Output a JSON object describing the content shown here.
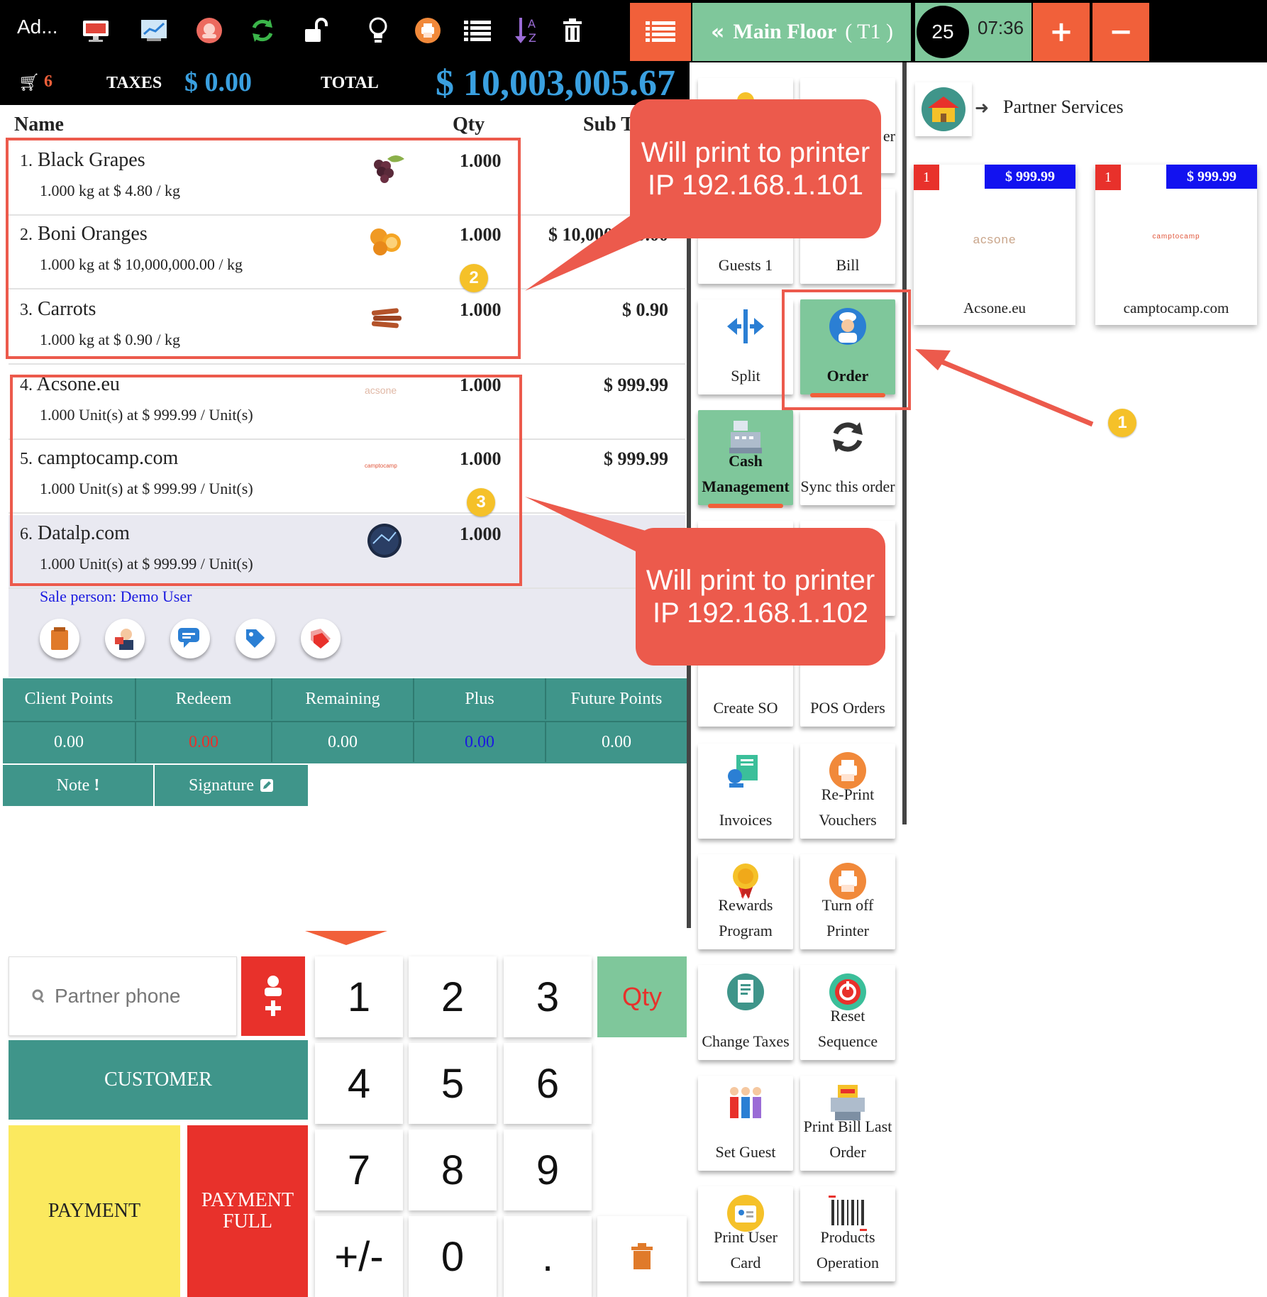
{
  "toolbar": {
    "user_name": "Ad...",
    "floor_label": "Main Floor",
    "table_label": "( T1 )",
    "guest_count": "25",
    "clock": "07:36",
    "plus_label": "+",
    "minus_label": "−"
  },
  "totals": {
    "cart_count": "6",
    "taxes_label": "TAXES",
    "taxes_value": "$ 0.00",
    "total_label": "TOTAL",
    "total_value": "$ 10,003,005.67"
  },
  "order": {
    "col_name": "Name",
    "col_qty": "Qty",
    "col_sub": "Sub T",
    "lines": [
      {
        "num": "1.",
        "name": "Black Grapes",
        "detail": "1.000 kg at $ 4.80 / kg",
        "qty": "1.000",
        "sub": "$"
      },
      {
        "num": "2.",
        "name": "Boni Oranges",
        "detail": "1.000 kg at $ 10,000,000.00 / kg",
        "qty": "1.000",
        "sub": "$ 10,000,000.00"
      },
      {
        "num": "3.",
        "name": "Carrots",
        "detail": "1.000 kg at $ 0.90 / kg",
        "qty": "1.000",
        "sub": "$ 0.90"
      },
      {
        "num": "4.",
        "name": "Acsone.eu",
        "detail": "1.000 Unit(s) at $ 999.99 / Unit(s)",
        "qty": "1.000",
        "sub": "$ 999.99"
      },
      {
        "num": "5.",
        "name": "camptocamp.com",
        "detail": "1.000 Unit(s) at $ 999.99 / Unit(s)",
        "qty": "1.000",
        "sub": "$ 999.99"
      },
      {
        "num": "6.",
        "name": "Datalp.com",
        "detail": "1.000 Unit(s) at $ 999.99 / Unit(s)",
        "qty": "1.000",
        "sub": ""
      }
    ],
    "salesperson": "Sale person: Demo User",
    "line4_logo": "acsone",
    "line5_logo": "camptocamp"
  },
  "loyalty": {
    "headers": [
      "Client Points",
      "Redeem",
      "Remaining",
      "Plus",
      "Future Points"
    ],
    "values": [
      "0.00",
      "0.00",
      "0.00",
      "0.00",
      "0.00"
    ],
    "note_label": "Note",
    "signature_label": "Signature"
  },
  "controls": {
    "partner_placeholder": "Partner phone",
    "customer_label": "CUSTOMER",
    "payment_label": "PAYMENT",
    "payment_full_label": "PAYMENT FULL",
    "keys": [
      "1",
      "2",
      "3",
      "4",
      "5",
      "6",
      "7",
      "8",
      "9",
      "+/-",
      "0",
      "."
    ],
    "qty_label": "Qty"
  },
  "tiles": {
    "guests": "Guests 1",
    "bill": "Bill",
    "split": "Split",
    "order": "Order",
    "cash_management": "Cash Management",
    "sync_order": "Sync this order",
    "create_so": "Create SO",
    "pos_orders": "POS Orders",
    "invoices": "Invoices",
    "reprint_vouchers": "Re-Print Vouchers",
    "rewards_program": "Rewards Program",
    "turn_off_printer": "Turn off Printer",
    "change_taxes": "Change Taxes",
    "reset_sequence": "Reset Sequence",
    "set_guest": "Set Guest",
    "print_bill_last_order": "Print Bill Last Order",
    "print_user_card": "Print User Card",
    "products_operation": "Products Operation",
    "partial_label": "er"
  },
  "partner_services": {
    "title": "Partner Services",
    "products": [
      {
        "qty": "1",
        "price": "$ 999.99",
        "logo": "acsone",
        "name": "Acsone.eu"
      },
      {
        "qty": "1",
        "price": "$ 999.99",
        "logo": "camptocamp",
        "name": "camptocamp.com"
      }
    ]
  },
  "annotations": {
    "callout_1": "Will print to printer IP 192.168.1.101",
    "callout_2": "Will print to printer IP 192.168.1.102",
    "badge_1": "1",
    "badge_2": "2",
    "badge_3": "3"
  },
  "colors": {
    "accent_orange": "#f1603a",
    "teal": "#3f958a",
    "mint": "#7fc79b",
    "annotation_red": "#ec5a4c",
    "badge_yellow": "#f5c129",
    "price_blue": "#3aa0e0"
  }
}
